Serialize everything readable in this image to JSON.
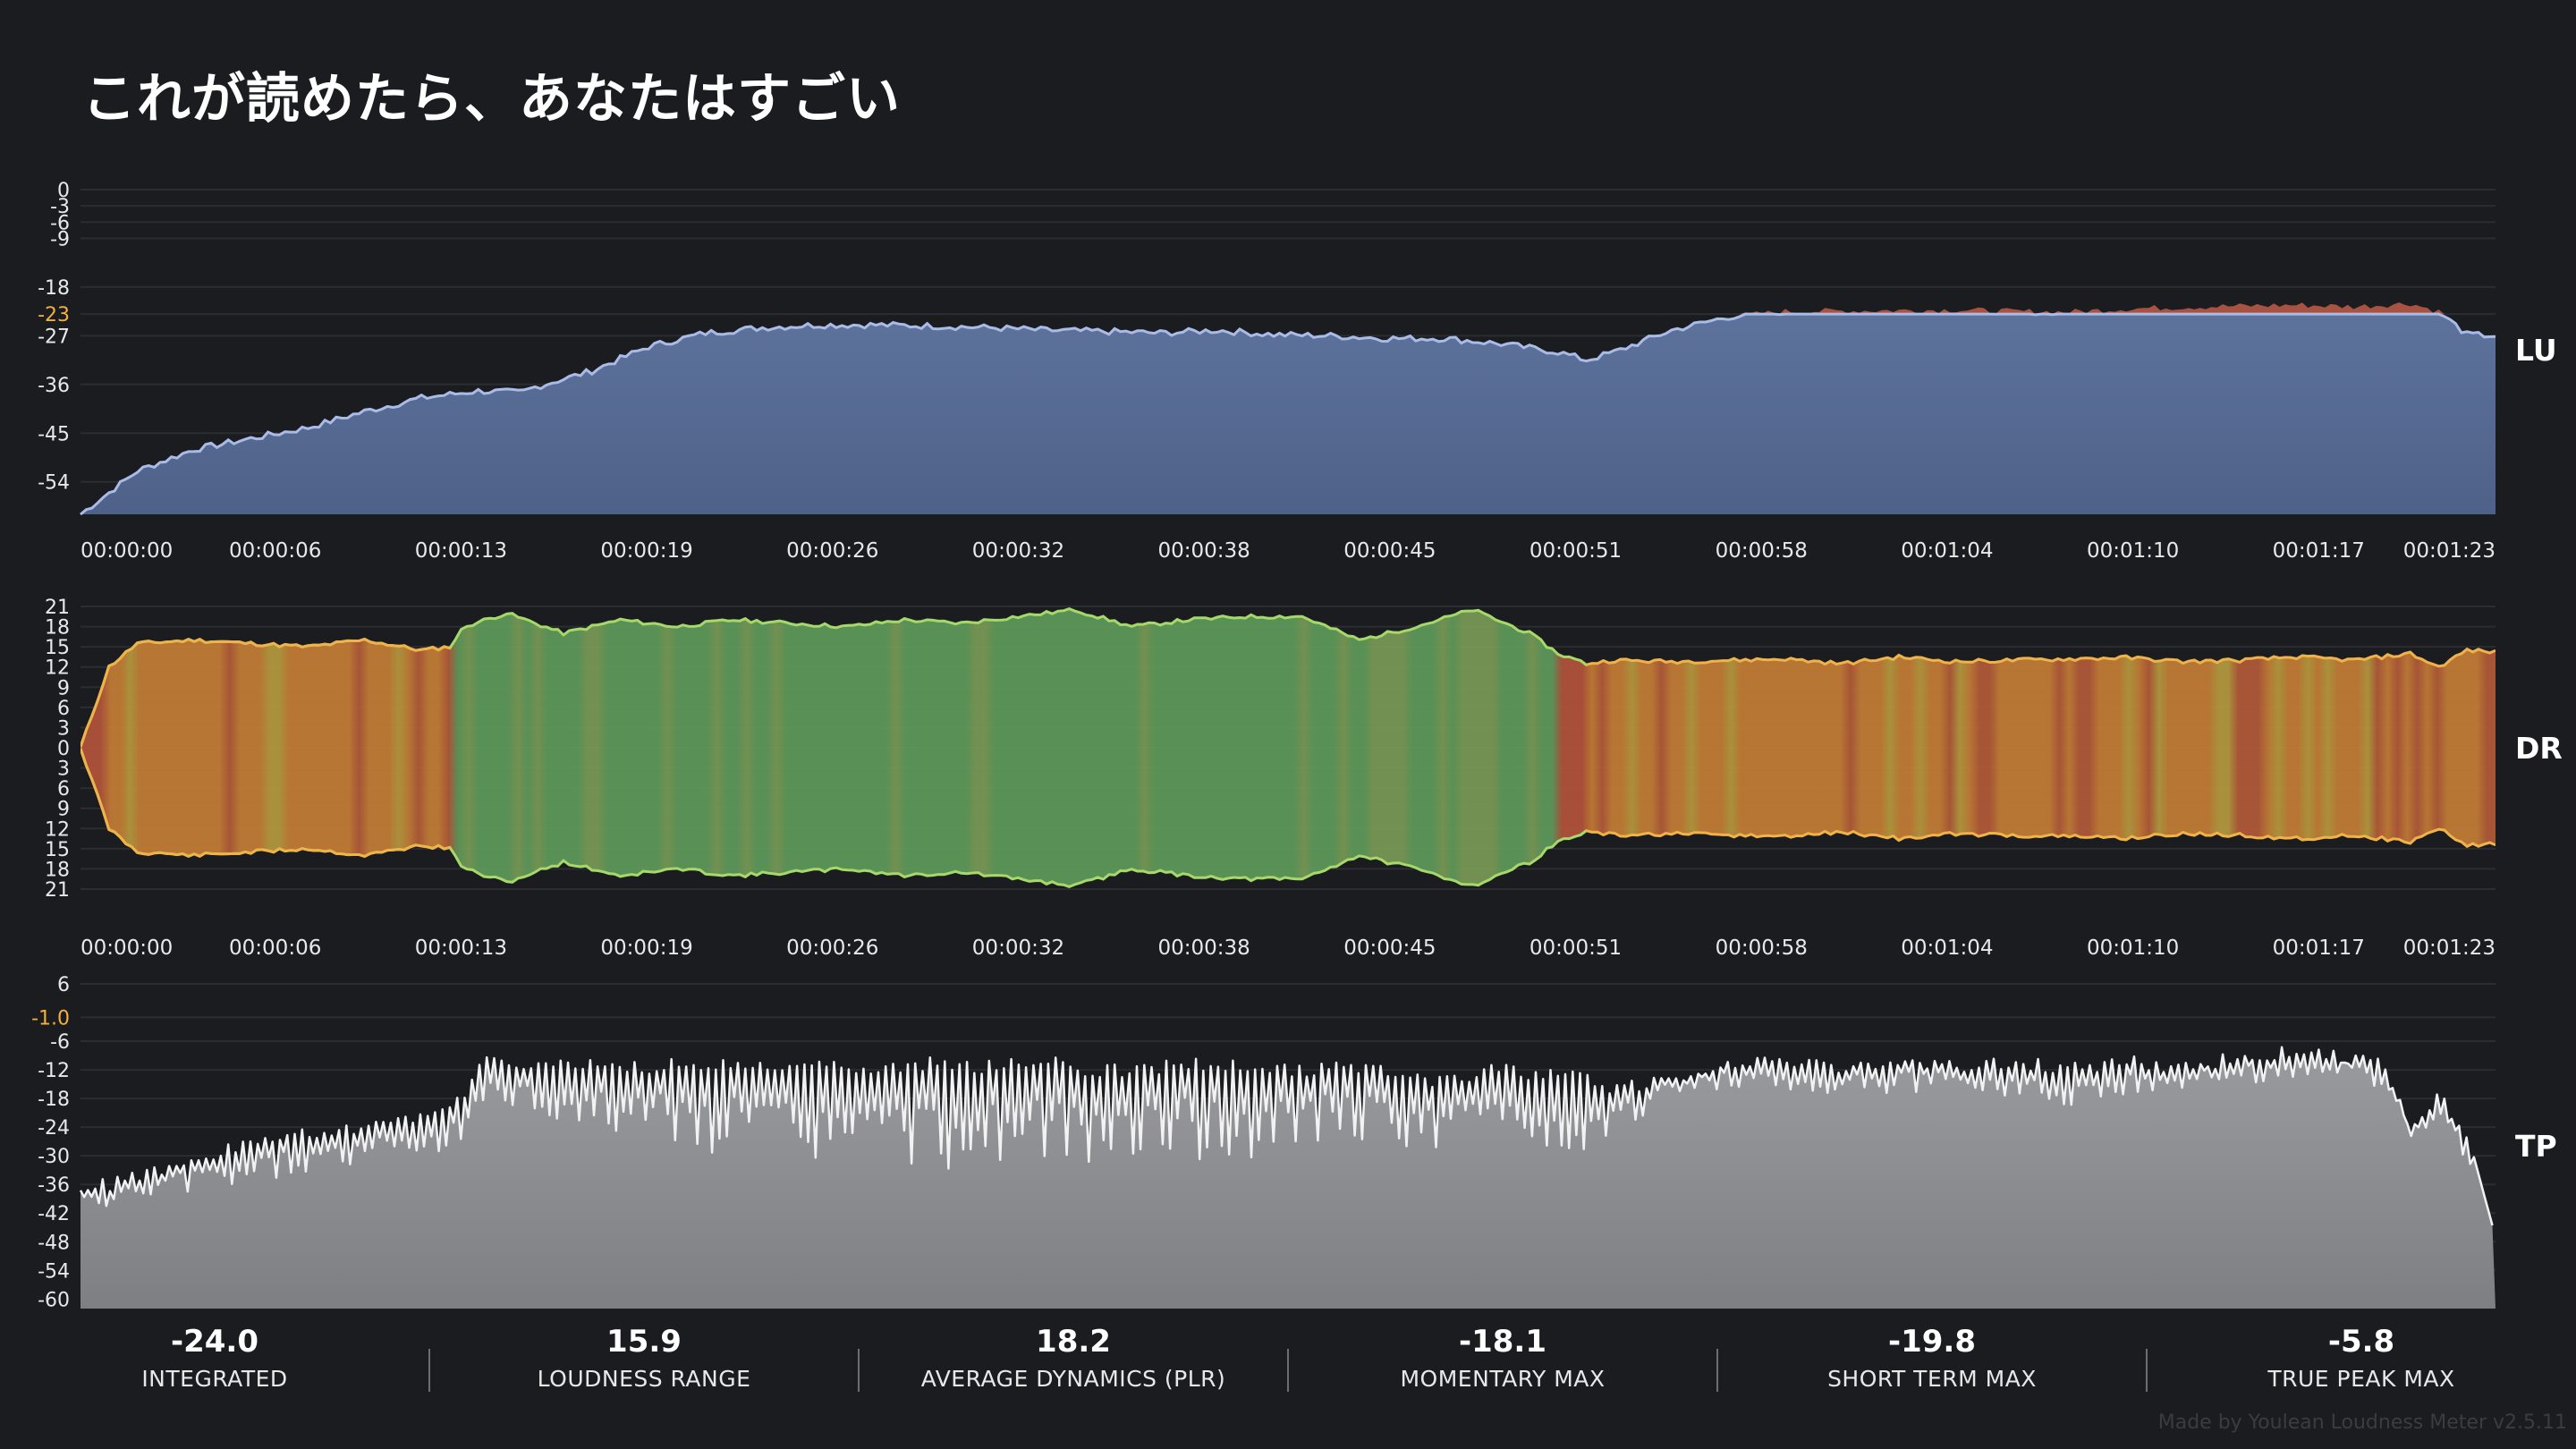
{
  "title": "これが読めたら、あなたはすごい",
  "credit": "Made by Youlean Loudness Meter v2.5.11",
  "colors": {
    "background": "#1b1c1f",
    "lu_fill": "#5a6f98",
    "lu_line": "#a9bbe6",
    "lu_over": "#b05645",
    "dr_green": "#5e9a5a",
    "dr_orange": "#c47d35",
    "dr_red": "#b3533a",
    "dr_line_green": "#a6d86a",
    "dr_line_orange": "#f0b34a",
    "tp_fill": "#8e8f93",
    "tp_line": "#f2f2f2",
    "target_label": "#f2b13c",
    "grid": "#2c2d31"
  },
  "chart_data": [
    {
      "type": "area",
      "label": "LU",
      "y_ticks": [
        "0",
        "-3",
        "-6",
        "-9",
        "-18",
        "-23",
        "-27",
        "-36",
        "-45",
        "-54"
      ],
      "highlight_tick": "-23",
      "ylim": [
        -60,
        0
      ],
      "target": -23,
      "x_tick_labels": [
        "00:00:00",
        "00:00:06",
        "00:00:13",
        "00:00:19",
        "00:00:26",
        "00:00:32",
        "00:00:38",
        "00:00:45",
        "00:00:51",
        "00:00:58",
        "00:01:04",
        "00:01:10",
        "00:01:17",
        "00:01:23"
      ],
      "x_seconds": [
        0,
        2,
        4,
        6,
        8,
        10,
        12,
        14,
        15.5,
        16,
        18,
        20,
        22,
        24,
        26,
        28,
        30,
        32,
        34,
        36,
        38,
        40,
        42,
        44,
        46,
        48,
        50,
        52,
        53,
        54,
        56,
        58,
        60,
        62,
        64,
        66,
        68,
        70,
        72,
        74,
        76,
        78,
        80,
        82,
        83,
        84,
        85
      ],
      "y_values": [
        -60,
        -52,
        -48,
        -46,
        -44,
        -41,
        -38.5,
        -37.2,
        -37.5,
        -36.5,
        -33.5,
        -29,
        -26.5,
        -25.5,
        -25,
        -25,
        -25.2,
        -25.5,
        -26,
        -26.2,
        -26.5,
        -26,
        -26.8,
        -27,
        -27.5,
        -27.5,
        -28.5,
        -30,
        -31.5,
        -30,
        -26,
        -23.5,
        -22.5,
        -22.4,
        -22.3,
        -22.2,
        -22.5,
        -22.6,
        -22.0,
        -21.7,
        -21.5,
        -21.3,
        -21.6,
        -21.0,
        -22.5,
        -26.8,
        -27
      ]
    },
    {
      "type": "area",
      "label": "DR",
      "y_ticks": [
        "21",
        "18",
        "15",
        "12",
        "9",
        "6",
        "3",
        "0",
        "3",
        "6",
        "9",
        "12",
        "15",
        "18",
        "21"
      ],
      "ylim": [
        -21,
        21
      ],
      "x_tick_labels": [
        "00:00:00",
        "00:00:06",
        "00:00:13",
        "00:00:19",
        "00:00:26",
        "00:00:32",
        "00:00:38",
        "00:00:45",
        "00:00:51",
        "00:00:58",
        "00:01:04",
        "00:01:10",
        "00:01:17",
        "00:01:23"
      ],
      "x_seconds": [
        0,
        0.5,
        1,
        2,
        4,
        6,
        8,
        10,
        12,
        13,
        13.5,
        15,
        17,
        19,
        21,
        23,
        25,
        27,
        29,
        31,
        33,
        35,
        37,
        39,
        41,
        43,
        45,
        47,
        49,
        51,
        52,
        53,
        54,
        56,
        58,
        60,
        62,
        64,
        66,
        68,
        70,
        72,
        74,
        76,
        78,
        80,
        82,
        83,
        84,
        85
      ],
      "half_range_values": [
        0,
        6,
        12,
        15.5,
        16,
        15.5,
        15,
        16,
        14.5,
        15,
        18,
        20,
        17,
        19,
        18,
        19,
        18.5,
        18,
        19,
        18.5,
        19.5,
        20.5,
        18,
        19,
        19.5,
        19.5,
        16,
        18,
        20.5,
        17,
        14,
        12.5,
        13,
        12.8,
        13,
        13.2,
        12.5,
        13.5,
        12.8,
        13,
        13.2,
        13.4,
        12.8,
        13,
        13.5,
        13,
        14,
        12,
        14.5,
        14.2
      ],
      "character": [
        "red",
        "red",
        "orange",
        "orange",
        "orange",
        "orange",
        "orange",
        "orange",
        "orange",
        "green",
        "green",
        "green",
        "green",
        "green",
        "green",
        "green",
        "green",
        "green",
        "green",
        "green",
        "green",
        "green",
        "green",
        "green",
        "green",
        "green",
        "green",
        "green",
        "green",
        "green",
        "red",
        "orange",
        "orange",
        "orange",
        "orange",
        "orange",
        "orange",
        "orange",
        "orange",
        "orange",
        "orange",
        "orange",
        "orange",
        "orange",
        "orange",
        "orange",
        "orange",
        "orange",
        "orange",
        "orange"
      ]
    },
    {
      "type": "area",
      "label": "TP",
      "y_ticks": [
        "6",
        "-1.0",
        "-6",
        "-12",
        "-18",
        "-24",
        "-30",
        "-36",
        "-42",
        "-48",
        "-54",
        "-60"
      ],
      "highlight_tick": "-1.0",
      "ylim": [
        -62,
        6
      ],
      "x_tick_labels": [],
      "x_seconds": [
        0,
        2,
        4,
        6,
        8,
        10,
        12,
        13.5,
        14,
        16,
        18,
        20,
        22,
        24,
        26,
        28,
        30,
        32,
        34,
        36,
        38,
        40,
        42,
        44,
        46,
        48,
        50,
        51,
        52,
        54,
        56,
        58,
        60,
        62,
        64,
        66,
        68,
        70,
        72,
        74,
        76,
        78,
        80,
        81,
        82,
        83,
        84,
        85
      ],
      "upper_values": [
        -36,
        -33,
        -29,
        -26,
        -24,
        -23,
        -21,
        -17,
        -8,
        -10,
        -9,
        -10,
        -9,
        -10,
        -9,
        -11,
        -9,
        -10,
        -9,
        -11,
        -10,
        -9,
        -11,
        -10,
        -11,
        -13,
        -10,
        -12,
        -11,
        -15,
        -12,
        -10,
        -9,
        -10,
        -9,
        -10,
        -9,
        -10,
        -9,
        -10,
        -8,
        -7,
        -8,
        -9,
        -22,
        -16,
        -25,
        -47
      ],
      "lower_values": [
        -42,
        -40,
        -38,
        -36,
        -34,
        -32,
        -30,
        -28,
        -20,
        -22,
        -26,
        -24,
        -30,
        -28,
        -32,
        -30,
        -34,
        -32,
        -30,
        -34,
        -28,
        -32,
        -30,
        -26,
        -28,
        -30,
        -24,
        -28,
        -32,
        -26,
        -18,
        -16,
        -16,
        -18,
        -17,
        -16,
        -18,
        -20,
        -17,
        -16,
        -15,
        -14,
        -14,
        -16,
        -28,
        -24,
        -32,
        -47
      ]
    }
  ],
  "stats": [
    {
      "value": "-24.0",
      "label": "INTEGRATED"
    },
    {
      "value": "15.9",
      "label": "LOUDNESS RANGE"
    },
    {
      "value": "18.2",
      "label": "AVERAGE DYNAMICS (PLR)"
    },
    {
      "value": "-18.1",
      "label": "MOMENTARY MAX"
    },
    {
      "value": "-19.8",
      "label": "SHORT TERM MAX"
    },
    {
      "value": "-5.8",
      "label": "TRUE PEAK MAX"
    }
  ]
}
